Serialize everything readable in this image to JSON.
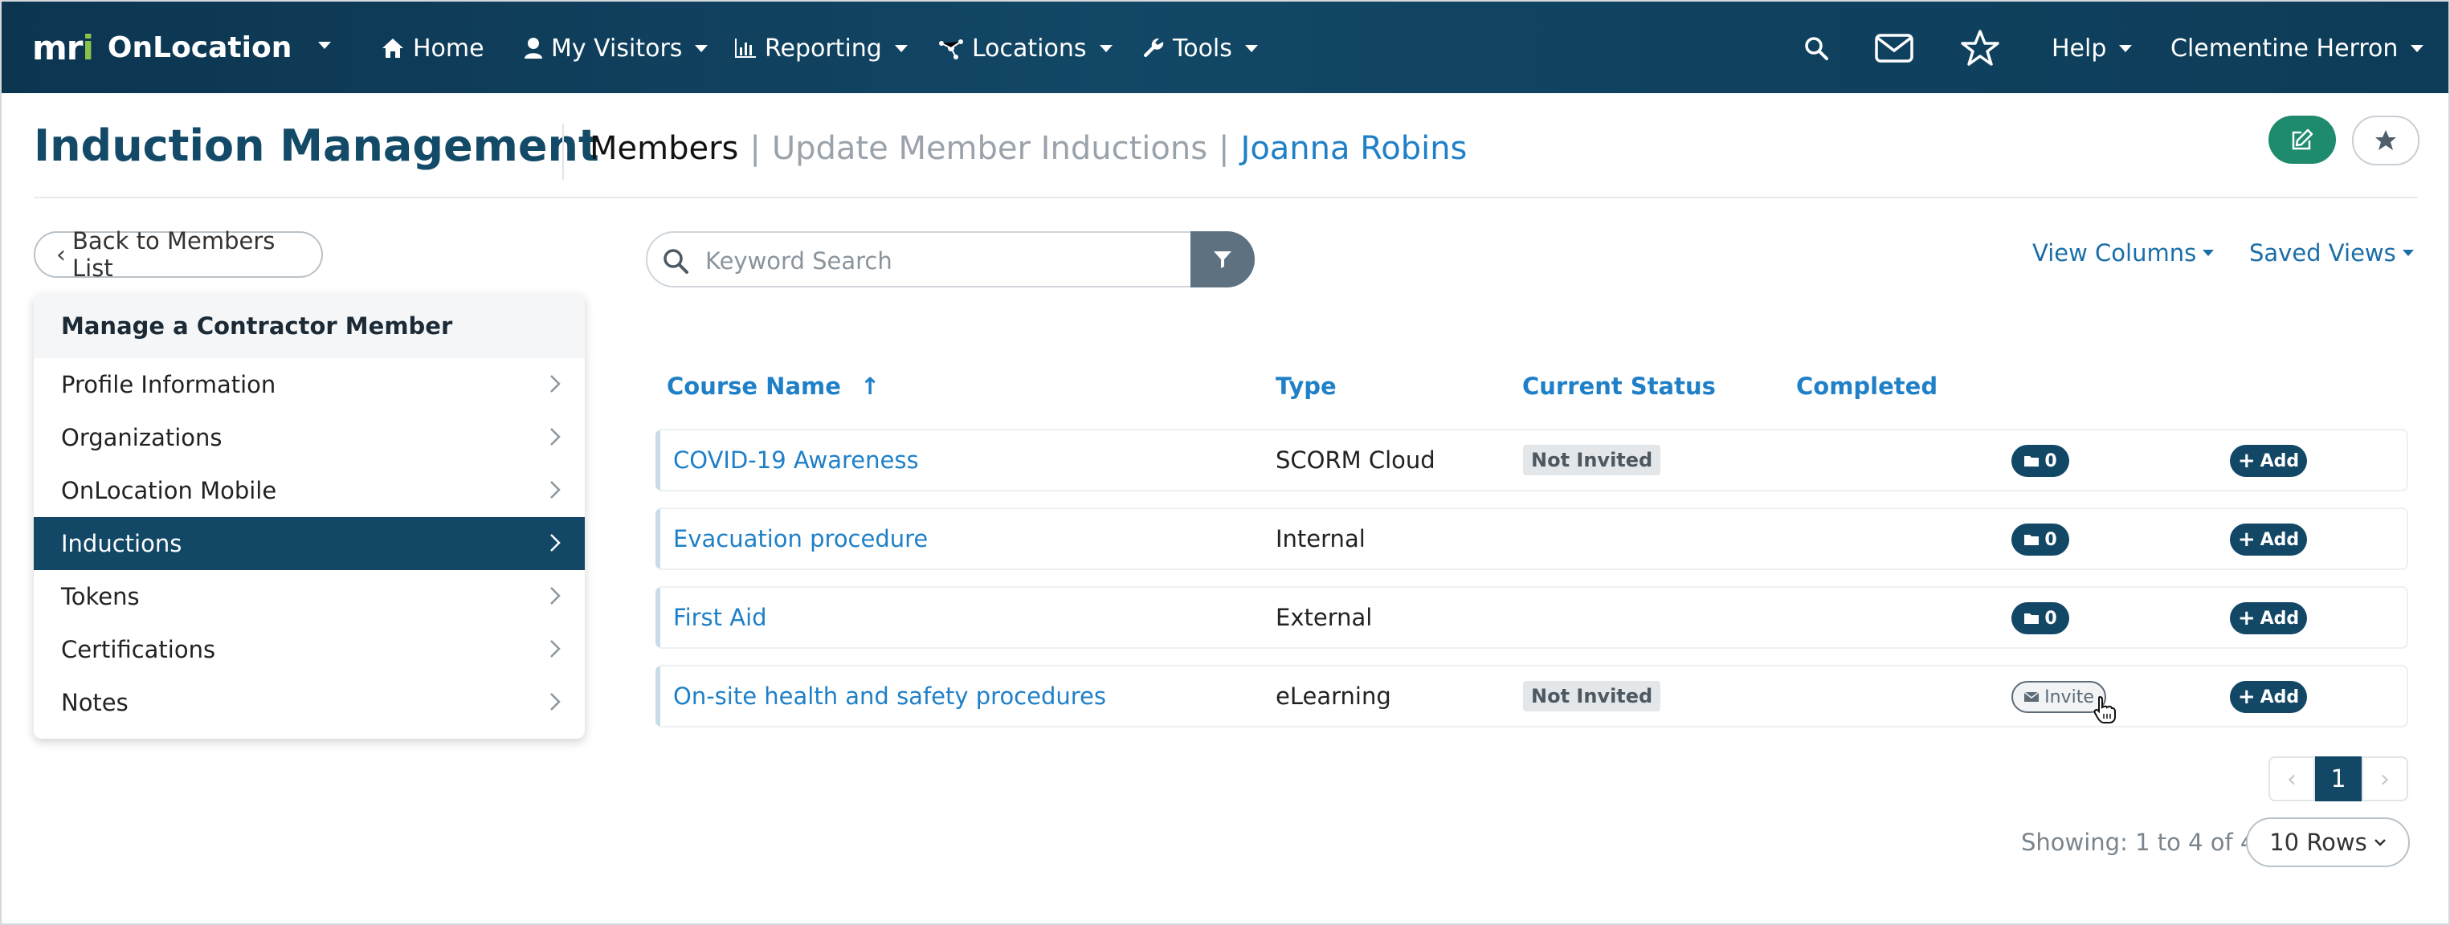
{
  "app": {
    "logo_mark": "mri",
    "name": "OnLocation"
  },
  "nav": {
    "items": [
      {
        "label": "Home",
        "icon": "home-icon"
      },
      {
        "label": "My Visitors",
        "icon": "user-icon"
      },
      {
        "label": "Reporting",
        "icon": "bar-chart-icon"
      },
      {
        "label": "Locations",
        "icon": "network-icon"
      },
      {
        "label": "Tools",
        "icon": "wrench-icon"
      }
    ],
    "help": "Help",
    "user": "Clementine Herron"
  },
  "header": {
    "title": "Induction Management",
    "crumbs": [
      "Members",
      "Update Member Inductions",
      "Joanna Robins"
    ],
    "separator": "|"
  },
  "sidebar": {
    "back": "Back to Members List",
    "heading": "Manage a Contractor Member",
    "items": [
      {
        "label": "Profile Information"
      },
      {
        "label": "Organizations"
      },
      {
        "label": "OnLocation Mobile"
      },
      {
        "label": "Inductions",
        "active": true
      },
      {
        "label": "Tokens"
      },
      {
        "label": "Certifications"
      },
      {
        "label": "Notes"
      }
    ]
  },
  "toolbar": {
    "search_placeholder": "Keyword Search",
    "view_columns": "View Columns",
    "saved_views": "Saved Views"
  },
  "table": {
    "columns": [
      "Course Name",
      "Type",
      "Current Status",
      "Completed"
    ],
    "sort_indicator": "↑",
    "rows": [
      {
        "course": "COVID-19 Awareness",
        "type": "SCORM Cloud",
        "status": "Not Invited",
        "completed": "",
        "action": "0",
        "add": "Add"
      },
      {
        "course": "Evacuation procedure",
        "type": "Internal",
        "status": "",
        "completed": "",
        "action": "0",
        "add": "Add"
      },
      {
        "course": "First Aid",
        "type": "External",
        "status": "",
        "completed": "",
        "action": "0",
        "add": "Add"
      },
      {
        "course": "On-site health and safety procedures",
        "type": "eLearning",
        "status": "Not Invited",
        "completed": "",
        "action": "Invite",
        "add": "Add"
      }
    ]
  },
  "pagination": {
    "current": "1",
    "prev": "‹",
    "next": "›",
    "showing": "Showing: 1 to 4 of 4",
    "rows_per_page": "10 Rows"
  },
  "colors": {
    "nav_bg": "#124766",
    "link": "#1f80c8",
    "edit_green": "#1e8a6e"
  }
}
